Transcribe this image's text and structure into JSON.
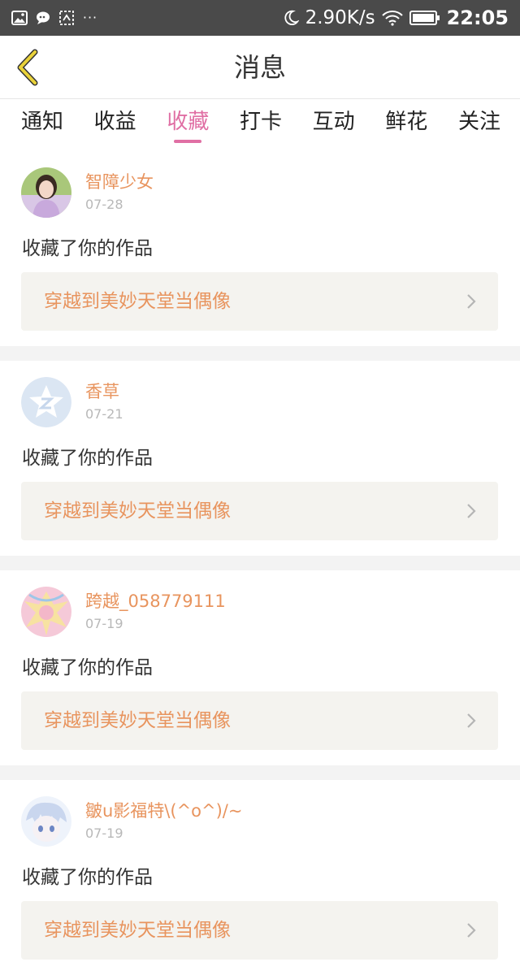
{
  "status_bar": {
    "net_speed": "2.90K/s",
    "time": "22:05",
    "left_icons": [
      "image-icon",
      "chat-bubble-icon",
      "screenshot-icon",
      "more-dots-icon"
    ],
    "right_icons": [
      "moon-icon",
      "wifi-icon",
      "battery-icon"
    ],
    "background": "#4a4a4a"
  },
  "header": {
    "title": "消息",
    "back_icon": "chevron-left-icon",
    "back_color": "#e9d23a"
  },
  "tabs": [
    {
      "label": "通知",
      "active": false
    },
    {
      "label": "收益",
      "active": false
    },
    {
      "label": "收藏",
      "active": true
    },
    {
      "label": "打卡",
      "active": false
    },
    {
      "label": "互动",
      "active": false
    },
    {
      "label": "鲜花",
      "active": false
    },
    {
      "label": "关注",
      "active": false
    }
  ],
  "accent_color": "#e06fa4",
  "items": [
    {
      "username": "智障少女",
      "date": "07-28",
      "message": "收藏了你的作品",
      "work_title": "穿越到美妙天堂当偶像",
      "avatar": "girl-photo-avatar"
    },
    {
      "username": "香草",
      "date": "07-21",
      "message": "收藏了你的作品",
      "work_title": "穿越到美妙天堂当偶像",
      "avatar": "default-z-avatar"
    },
    {
      "username": "跨越_058779111",
      "date": "07-19",
      "message": "收藏了你的作品",
      "work_title": "穿越到美妙天堂当偶像",
      "avatar": "anime-pink-avatar"
    },
    {
      "username": "皺u影福特\\(^o^)/~",
      "date": "07-19",
      "message": "收藏了你的作品",
      "work_title": "穿越到美妙天堂当偶像",
      "avatar": "anime-blue-avatar"
    }
  ]
}
